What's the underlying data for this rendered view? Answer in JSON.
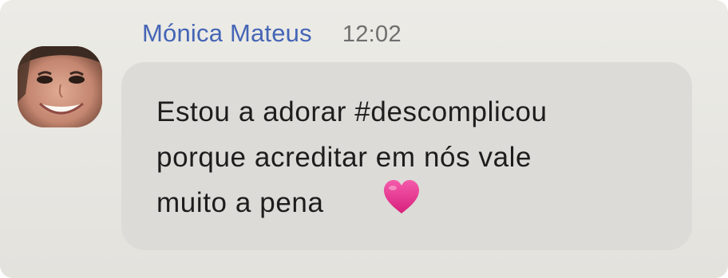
{
  "message": {
    "sender": "Mónica Mateus",
    "time": "12:02",
    "text": "Estou a adorar #descomplicou\nporque acreditar em nós vale\nmuito a pena",
    "emoji": "heart-icon",
    "emoji_color": "#e8388f"
  },
  "colors": {
    "sender_name": "#4565b5",
    "timestamp": "#6f6f6f",
    "bubble": "#dcdbd7",
    "background": "#e9e8e3"
  }
}
